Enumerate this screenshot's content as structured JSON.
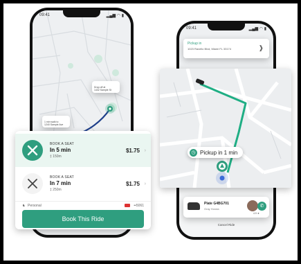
{
  "left_phone": {
    "status": {
      "time": "09:41",
      "signal": "▂▄▆ ◠ ▮"
    },
    "map_labels": {
      "destination_tag": "Drop off at\n1432 Sample St",
      "origin_tag": "1 min walk to\n1240 Sample Ave"
    },
    "rides": [
      {
        "label": "BOOK A SEAT",
        "eta": "In 5 min",
        "distance": "‡ 150m",
        "price": "$1.75"
      },
      {
        "label": "BOOK A SEAT",
        "eta": "In 7 min",
        "distance": "‡ 250m",
        "price": "$1.75"
      }
    ],
    "payment": {
      "method": "Personal",
      "card": "••5061"
    },
    "book_button": "Book This Ride"
  },
  "right_phone": {
    "status": {
      "time": "09:41",
      "signal": "▂▄▆ ◠ ▮"
    },
    "pickup_card": {
      "title": "Pickup in",
      "address": "1023 Ravello Blvd, Miami FL 33174"
    },
    "pickup_pill": "Pickup in 1 min",
    "driver": {
      "plate": "Plate G4BG701",
      "car": "Gray Honda",
      "rating": "4.9 ★"
    },
    "bottom_bar": "Cancel Ride"
  },
  "colors": {
    "accent": "#2f9e7f",
    "route_dark": "#1f3f8a",
    "route_green": "#1fae84"
  }
}
